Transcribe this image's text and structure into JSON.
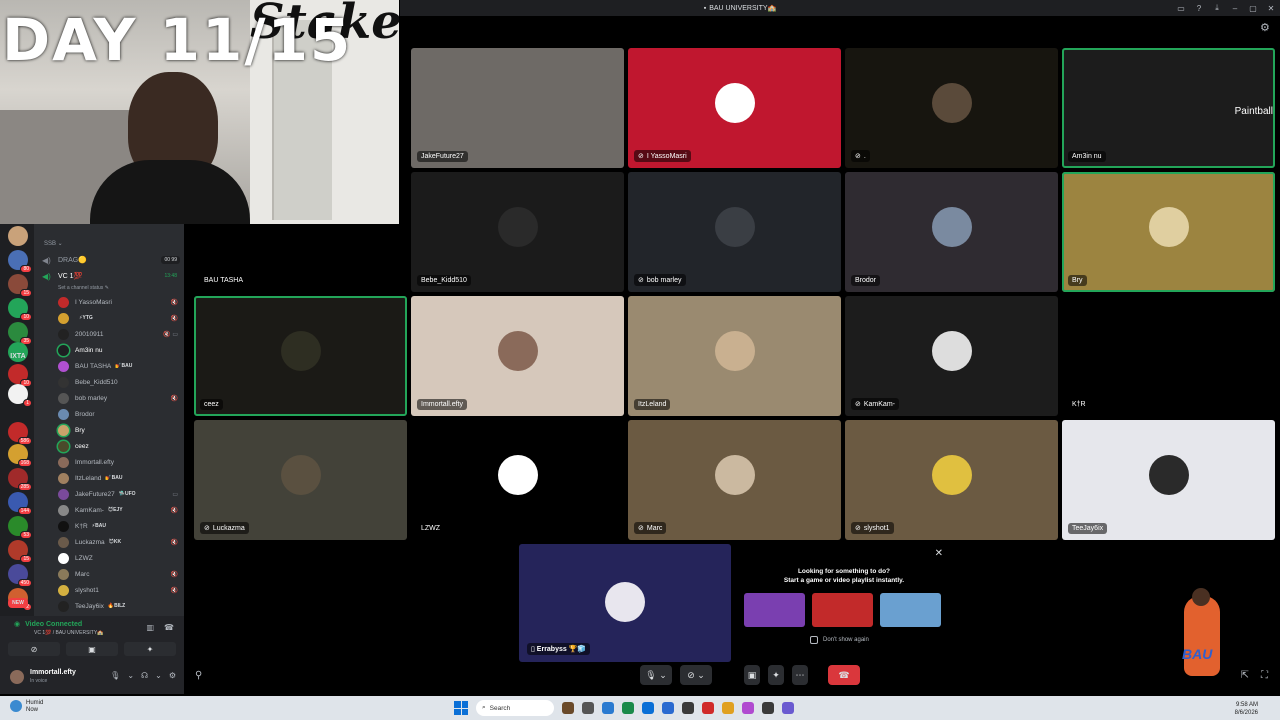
{
  "overlay": {
    "day_text": "DAY 11/15",
    "cam_brand": "Stake"
  },
  "titlebar": {
    "title": "BAU UNIVERSITY🏫"
  },
  "rail": {
    "servers": [
      {
        "color": "#c9a27a",
        "badge": ""
      },
      {
        "color": "#4a6fb5",
        "badge": "80"
      },
      {
        "color": "#8a4a3a",
        "badge": "15"
      },
      {
        "color": "#23a559",
        "badge": "10"
      },
      {
        "color": "#2b8a3e",
        "badge": "35"
      },
      {
        "color": "#23a559",
        "badge": ""
      },
      {
        "color": "#c22a2a",
        "badge": "10"
      },
      {
        "color": "#f2f2f2",
        "badge": "1"
      },
      {
        "color": "#3a3a3a",
        "badge": ""
      },
      {
        "color": "#c22a2a",
        "badge": "586"
      },
      {
        "color": "#d4a030",
        "badge": "168"
      },
      {
        "color": "#a02a2a",
        "badge": "285"
      },
      {
        "color": "#3a5ab0",
        "badge": "144"
      },
      {
        "color": "#2a8a2a",
        "badge": "53"
      },
      {
        "color": "#b03a2a",
        "badge": "15"
      },
      {
        "color": "#4a4a9a",
        "badge": "450"
      },
      {
        "color": "#d06030",
        "badge": "2"
      }
    ],
    "text_server": "IXTA",
    "new_label": "NEW"
  },
  "channels": {
    "category": "SSB",
    "drag": {
      "label": "DRAG🟡",
      "count": "00 99"
    },
    "vc": {
      "label": "VC 1💯",
      "time": "13:48",
      "status": "Set a channel status"
    },
    "members": [
      {
        "name": "I YassoMasri",
        "tag": "",
        "color": "#c22a2a",
        "icon": "🔇"
      },
      {
        "name": "",
        "tag": "⚡YTG",
        "color": "#d4a030",
        "icon": "🔇"
      },
      {
        "name": "20010911",
        "tag": "",
        "color": "#222",
        "icon": "🔇 ▭"
      },
      {
        "name": "Am3in nu",
        "tag": "",
        "color": "#1e1f22",
        "icon": "",
        "green": true
      },
      {
        "name": "BAU TASHA",
        "tag": "💅BAU",
        "color": "#b050d0",
        "icon": ""
      },
      {
        "name": "Bebe_Kidd510",
        "tag": "",
        "color": "#333",
        "icon": ""
      },
      {
        "name": "bob marley",
        "tag": "",
        "color": "#555",
        "icon": "🔇"
      },
      {
        "name": "Brodor",
        "tag": "",
        "color": "#6a8ab0",
        "icon": ""
      },
      {
        "name": "Bry",
        "tag": "",
        "color": "#c9a26a",
        "icon": "",
        "green": true
      },
      {
        "name": "ceez",
        "tag": "",
        "color": "#4a4a2a",
        "icon": "",
        "green": true
      },
      {
        "name": "Immortall.efty",
        "tag": "",
        "color": "#8a6a5a",
        "icon": ""
      },
      {
        "name": "ItzLeland",
        "tag": "💅BAU",
        "color": "#a08060",
        "icon": ""
      },
      {
        "name": "JakeFuture27",
        "tag": "🛸UFO",
        "color": "#7a4a9a",
        "icon": "▭"
      },
      {
        "name": "KamKam-",
        "tag": "😈EJY",
        "color": "#888",
        "icon": "🔇"
      },
      {
        "name": "K†R",
        "tag": "⚡BAU",
        "color": "#111",
        "icon": ""
      },
      {
        "name": "Luckazma",
        "tag": "😈KK",
        "color": "#6a5a4a",
        "icon": "🔇"
      },
      {
        "name": "LZWZ",
        "tag": "",
        "color": "#fff",
        "icon": ""
      },
      {
        "name": "Marc",
        "tag": "",
        "color": "#8a7a5a",
        "icon": "🔇"
      },
      {
        "name": "slyshot1",
        "tag": "",
        "color": "#d4b040",
        "icon": "🔇"
      },
      {
        "name": "TeeJay6ix",
        "tag": "🔥BILZ",
        "color": "#222",
        "icon": ""
      }
    ]
  },
  "voice_panel": {
    "connected": "Video Connected",
    "sub": "VC 1💯 / BAU UNIVERSITY🏫",
    "user_name": "Immortall.efty",
    "user_status": "In voice"
  },
  "grid": {
    "tiles": [
      {
        "label": "JakeFuture27",
        "bg": "#6e6a66",
        "avatar": "",
        "muted": false,
        "speaking": false
      },
      {
        "label": "I YassoMasri",
        "bg": "#c0172f",
        "avatar": "#ffffff",
        "muted": true,
        "speaking": false
      },
      {
        "label": ".",
        "bg": "#17150f",
        "avatar": "#5a4a3a",
        "muted": true,
        "speaking": false
      },
      {
        "label": "Am3in nu",
        "bg": "#1c1c1c",
        "avatar": "",
        "muted": false,
        "speaking": true,
        "side_text": "Paintball"
      },
      {
        "label": "BAU TASHA",
        "bg": "#000000",
        "avatar": "",
        "muted": false,
        "speaking": false
      },
      {
        "label": "Bebe_Kidd510",
        "bg": "#1b1b1b",
        "avatar": "#2a2a2a",
        "muted": false,
        "speaking": false
      },
      {
        "label": "bob marley",
        "bg": "#22252a",
        "avatar": "#3a3e44",
        "muted": true,
        "speaking": false
      },
      {
        "label": "Brodor",
        "bg": "#2f2b31",
        "avatar": "#7a8aa0",
        "muted": false,
        "speaking": false
      },
      {
        "label": "Bry",
        "bg": "#9c8440",
        "avatar": "#e0cfa0",
        "muted": false,
        "speaking": true
      },
      {
        "label": "ceez",
        "bg": "#1b1a16",
        "avatar": "#2e2e22",
        "muted": false,
        "speaking": true
      },
      {
        "label": "Immortall.efty",
        "bg": "#d6c8bb",
        "avatar": "#8a6a5a",
        "muted": false,
        "speaking": false
      },
      {
        "label": "ItzLeland",
        "bg": "#9a8a70",
        "avatar": "#c9b090",
        "muted": false,
        "speaking": false
      },
      {
        "label": "KamKam-",
        "bg": "#1c1c1c",
        "avatar": "#dddddd",
        "muted": true,
        "speaking": false
      },
      {
        "label": "K†R",
        "bg": "#000000",
        "avatar": "",
        "muted": false,
        "speaking": false
      },
      {
        "label": "Luckazma",
        "bg": "#434239",
        "avatar": "#5a5040",
        "muted": true,
        "speaking": false
      },
      {
        "label": "LZWZ",
        "bg": "#000000",
        "avatar": "#ffffff",
        "muted": false,
        "speaking": false
      },
      {
        "label": "Marc",
        "bg": "#6b5a42",
        "avatar": "#cbb9a0",
        "muted": true,
        "speaking": false
      },
      {
        "label": "slyshot1",
        "bg": "#6b5a42",
        "avatar": "#e0c040",
        "muted": true,
        "speaking": false
      },
      {
        "label": "TeeJay6ix",
        "bg": "#e6e7ec",
        "avatar": "#2a2a2a",
        "muted": false,
        "speaking": false
      }
    ]
  },
  "stream_tile": {
    "label": "Errabyss 🏆🧊"
  },
  "activity": {
    "line1": "Looking for something to do?",
    "line2": "Start a game or video playlist instantly.",
    "game_colors": [
      "#7a3fb0",
      "#c22a2a",
      "#6aa0d0"
    ],
    "checkbox": "Don't show again"
  },
  "taskbar": {
    "weather_line1": "Humid",
    "weather_line2": "Now",
    "search": "Search",
    "time": "9:58 AM",
    "date": "8/6/2026",
    "apps": [
      "#6a4a2a",
      "#555",
      "#2a7ad0",
      "#1a8a4a",
      "#0a6fd6",
      "#2a6ad0",
      "#3a3a3a",
      "#d02a2a",
      "#e0a020",
      "#b04ad0",
      "#3a3a3a",
      "#6a5ad0"
    ]
  }
}
